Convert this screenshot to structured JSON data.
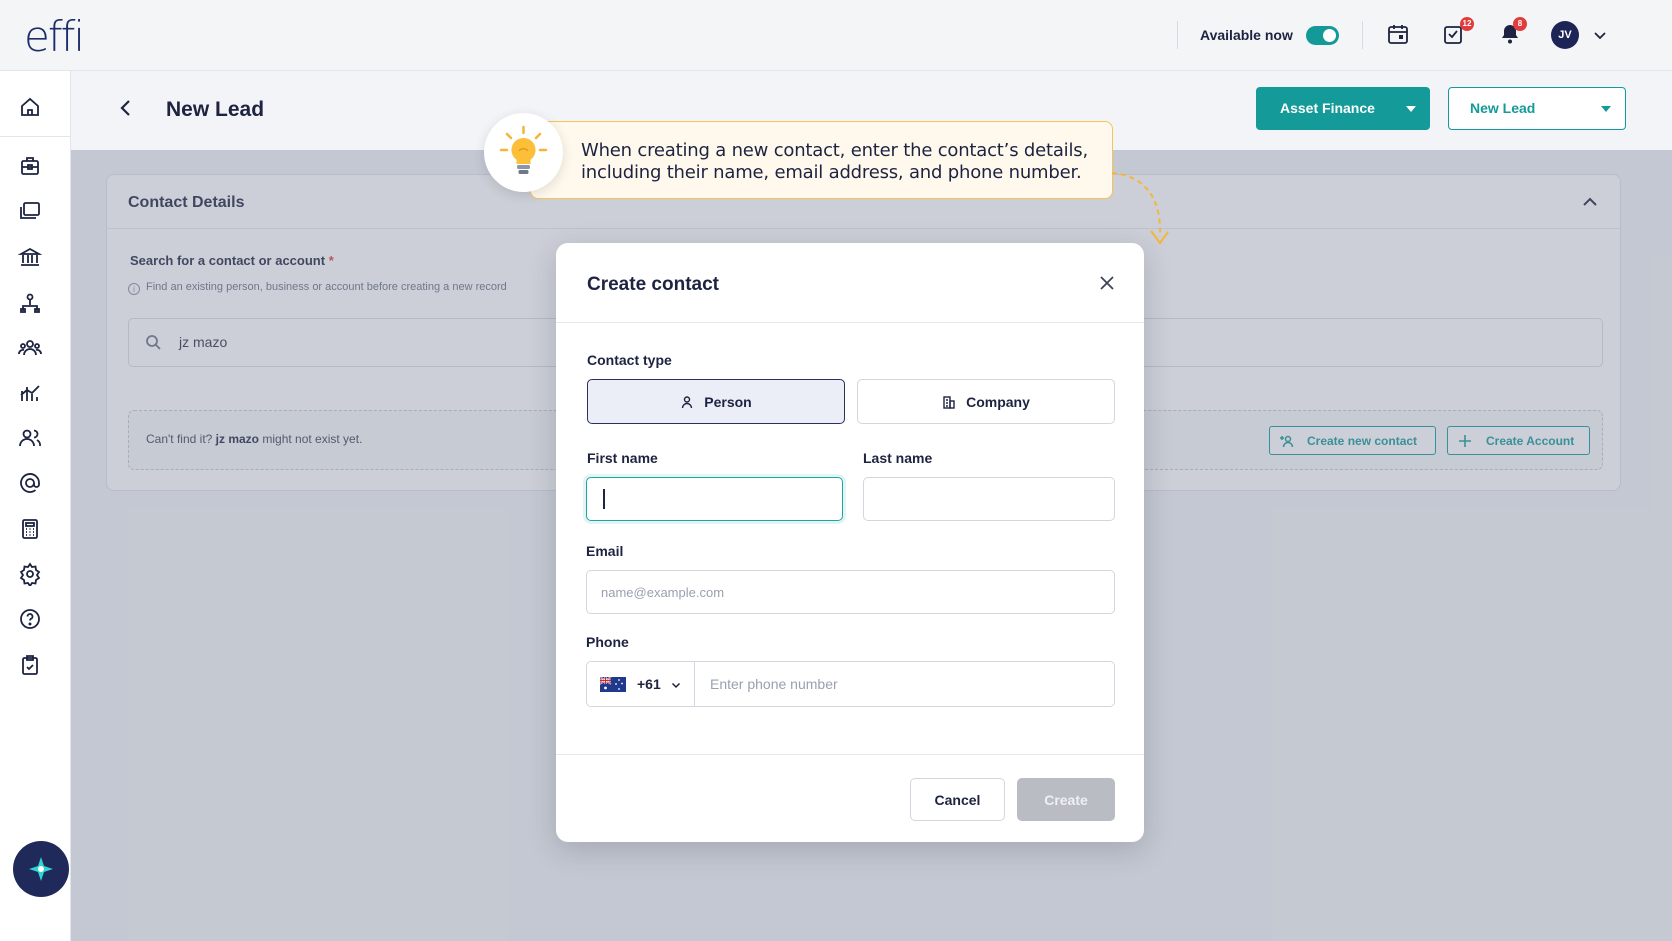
{
  "app": {
    "logo": "effi"
  },
  "topbar": {
    "availability_label": "Available now",
    "availability_on": true,
    "tasks_badge": "12",
    "notifications_badge": "8",
    "avatar_initials": "JV"
  },
  "page": {
    "title": "New Lead",
    "primary_button": "Asset Finance",
    "secondary_button": "New Lead"
  },
  "card": {
    "title": "Contact Details",
    "search_label": "Search for a contact or account",
    "required_mark": "*",
    "hint": "Find an existing person, business or account before creating a new record",
    "search_value": "jz mazo",
    "not_found_prefix": "Can't find it?",
    "not_found_term": "jz mazo",
    "not_found_suffix": "might not exist yet.",
    "create_contact_button": "Create new contact",
    "create_account_button": "Create Account"
  },
  "tip": {
    "line1": "When creating a new contact, enter the contact’s details,",
    "line2": "including their name, email address, and phone number."
  },
  "modal": {
    "title": "Create contact",
    "contact_type_label": "Contact type",
    "type_person": "Person",
    "type_company": "Company",
    "selected_type": "Person",
    "first_name_label": "First name",
    "first_name_value": "",
    "last_name_label": "Last name",
    "last_name_value": "",
    "email_label": "Email",
    "email_placeholder": "name@example.com",
    "phone_label": "Phone",
    "phone_country_code": "+61",
    "phone_placeholder": "Enter phone number",
    "cancel_button": "Cancel",
    "create_button": "Create"
  },
  "colors": {
    "accent": "#149a99",
    "navy": "#1d2340",
    "badge": "#e23b3b",
    "tip_border": "#f6c35a"
  },
  "sidebar_icons": [
    "home-icon",
    "briefcase-icon",
    "folders-icon",
    "bank-icon",
    "org-icon",
    "team-icon",
    "analytics-icon",
    "users-icon",
    "at-icon",
    "calculator-icon",
    "settings-icon",
    "help-icon",
    "clipboard-icon",
    "ai-sparkle-icon"
  ]
}
